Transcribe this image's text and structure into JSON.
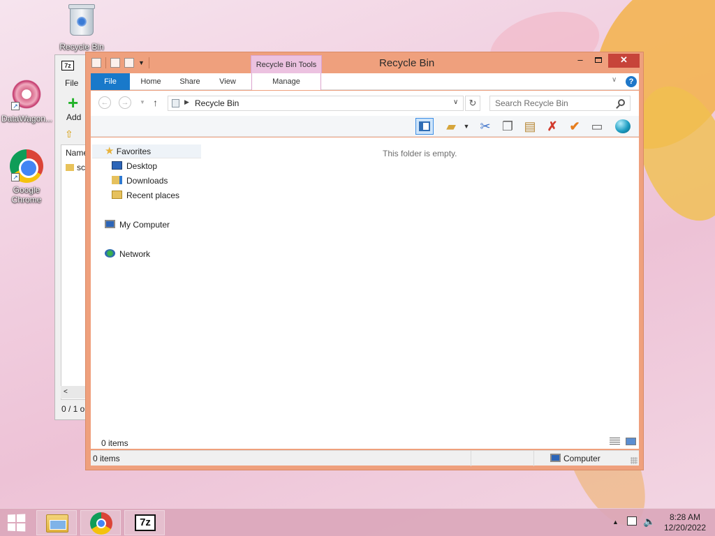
{
  "desktop": {
    "icons": [
      {
        "label": "Recycle Bin",
        "icon": "recycle-bin-icon"
      },
      {
        "label": "DataWagon...",
        "icon": "datawagon-icon"
      },
      {
        "label": "Google Chrome",
        "icon": "chrome-icon"
      }
    ]
  },
  "bg_window": {
    "logo": "7z",
    "menu_file": "File",
    "add_label": "Add",
    "column_name": "Name",
    "file_name": "sc",
    "scroll_left": "<",
    "status": "0 / 1 o"
  },
  "window": {
    "title": "Recycle Bin",
    "context_tab": "Recycle Bin Tools",
    "buttons": {
      "minimize": "–",
      "close": "✕"
    },
    "ribbon_tabs": {
      "file": "File",
      "home": "Home",
      "share": "Share",
      "view": "View",
      "manage": "Manage"
    },
    "help": "?",
    "address": {
      "path": "Recycle Bin",
      "search_placeholder": "Search Recycle Bin"
    },
    "nav_pane": {
      "favorites": "Favorites",
      "desktop": "Desktop",
      "downloads": "Downloads",
      "recent_places": "Recent places",
      "my_computer": "My Computer",
      "network": "Network"
    },
    "empty_message": "This folder is empty.",
    "item_count": "0 items",
    "status": {
      "items": "0 items",
      "location": "Computer"
    }
  },
  "taskbar": {
    "seven_zip": "7z",
    "clock_time": "8:28 AM",
    "clock_date": "12/20/2022"
  },
  "colors": {
    "window_frame": "#efa07d",
    "file_tab": "#1979ca",
    "context_tab": "#ecc2e0",
    "close_button": "#c7443a"
  }
}
